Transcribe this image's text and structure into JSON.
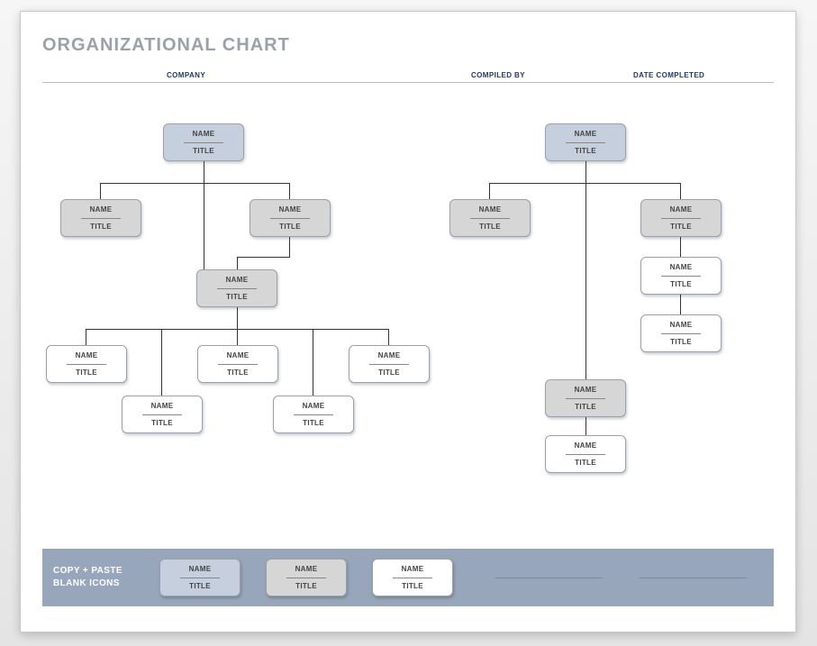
{
  "title": "ORGANIZATIONAL CHART",
  "header": {
    "company_label": "COMPANY",
    "compiled_label": "COMPILED BY",
    "date_label": "DATE COMPLETED"
  },
  "placeholder": {
    "name": "NAME",
    "title": "TITLE"
  },
  "nodes": {
    "left_top": {
      "name": "NAME",
      "title": "TITLE"
    },
    "left_c1": {
      "name": "NAME",
      "title": "TITLE"
    },
    "left_c2": {
      "name": "NAME",
      "title": "TITLE"
    },
    "left_mid": {
      "name": "NAME",
      "title": "TITLE"
    },
    "left_g1": {
      "name": "NAME",
      "title": "TITLE"
    },
    "left_g2": {
      "name": "NAME",
      "title": "TITLE"
    },
    "left_g3": {
      "name": "NAME",
      "title": "TITLE"
    },
    "left_g4": {
      "name": "NAME",
      "title": "TITLE"
    },
    "left_g5": {
      "name": "NAME",
      "title": "TITLE"
    },
    "right_top": {
      "name": "NAME",
      "title": "TITLE"
    },
    "right_c1": {
      "name": "NAME",
      "title": "TITLE"
    },
    "right_c2": {
      "name": "NAME",
      "title": "TITLE"
    },
    "right_w1": {
      "name": "NAME",
      "title": "TITLE"
    },
    "right_w2": {
      "name": "NAME",
      "title": "TITLE"
    },
    "right_low": {
      "name": "NAME",
      "title": "TITLE"
    },
    "right_bot": {
      "name": "NAME",
      "title": "TITLE"
    }
  },
  "footer": {
    "label_line1": "COPY + PASTE",
    "label_line2": "BLANK ICONS",
    "samples": {
      "blue": {
        "name": "NAME",
        "title": "TITLE"
      },
      "grey": {
        "name": "NAME",
        "title": "TITLE"
      },
      "white": {
        "name": "NAME",
        "title": "TITLE"
      }
    }
  }
}
